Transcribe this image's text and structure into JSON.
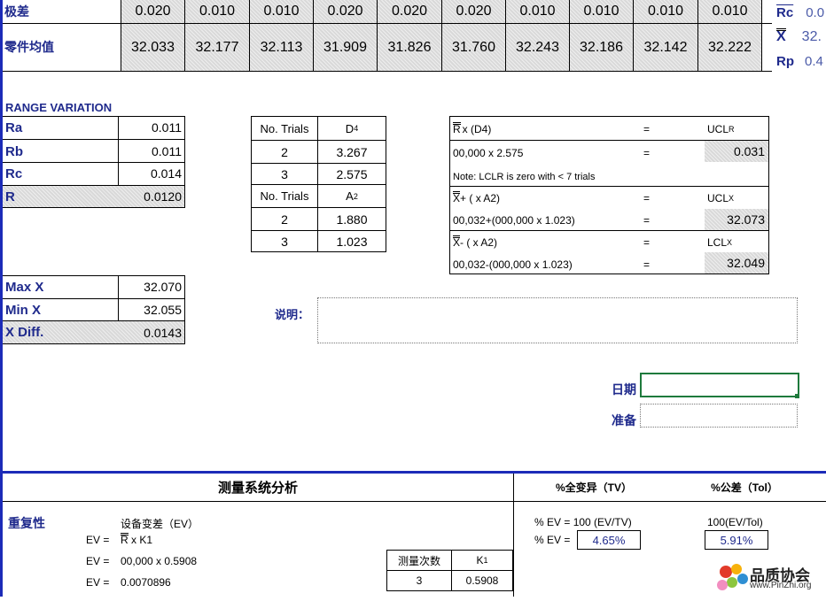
{
  "top": {
    "range_label": "极差",
    "avg_label": "零件均值",
    "ranges": [
      "0.020",
      "0.010",
      "0.010",
      "0.020",
      "0.020",
      "0.020",
      "0.010",
      "0.010",
      "0.010",
      "0.010"
    ],
    "avgs": [
      "32.033",
      "32.177",
      "32.113",
      "31.909",
      "31.826",
      "31.760",
      "32.243",
      "32.186",
      "32.142",
      "32.222"
    ],
    "side": [
      {
        "label": "Rc",
        "value": "0.0"
      },
      {
        "label": "X",
        "value": "32."
      },
      {
        "label": "Rp",
        "value": "0.4"
      }
    ]
  },
  "range_variation": {
    "title": "RANGE VARIATION",
    "rows": [
      {
        "label": "Ra",
        "value": "0.011"
      },
      {
        "label": "Rb",
        "value": "0.011"
      },
      {
        "label": "Rc",
        "value": "0.014"
      },
      {
        "label": "R",
        "value": "0.0120"
      }
    ]
  },
  "constants": {
    "d4_header": [
      "No. Trials",
      "D4"
    ],
    "d4_rows": [
      [
        "2",
        "3.267"
      ],
      [
        "3",
        "2.575"
      ]
    ],
    "a2_header": [
      "No. Trials",
      "A2"
    ],
    "a2_rows": [
      [
        "2",
        "1.880"
      ],
      [
        "3",
        "1.023"
      ]
    ]
  },
  "limits": {
    "r_formula": "x (D4)",
    "eq": "=",
    "ucl_r_label": "UCLR",
    "r_calc": "00,000 x 2.575",
    "ucl_r_value": "0.031",
    "note": "Note: LCLR is zero with < 7 trials",
    "uclx_formula": "+ ( x A2)",
    "ucl_x_label": "UCLX",
    "uclx_calc": "00,032+(000,000 x 1.023)",
    "ucl_x_value": "32.073",
    "lclx_formula": "- ( x A2)",
    "lcl_x_label": "LCLX",
    "lclx_calc": "00,032-(000,000 x 1.023)",
    "lcl_x_value": "32.049"
  },
  "x_stats": {
    "rows": [
      {
        "label": "Max X",
        "value": "32.070"
      },
      {
        "label": "Min X",
        "value": "32.055"
      },
      {
        "label": "X Diff.",
        "value": "0.0143"
      }
    ]
  },
  "notes": {
    "label": "说明：",
    "value": ""
  },
  "sign": {
    "date_label": "日期",
    "prep_label": "准备",
    "date_value": "",
    "prep_value": ""
  },
  "msa": {
    "title": "测量系统分析",
    "tv_header": "%全变异（TV）",
    "tol_header": "%公差（Tol）",
    "repeat_label": "重复性",
    "ev_title": "设备变差（EV）",
    "ev_formula_prefix": "EV =",
    "ev_formula": "x  K1",
    "ev_calc_prefix": "EV =",
    "ev_calc": "00,000 x 0.5908",
    "ev_result_prefix": "EV =",
    "ev_result": "0.0070896",
    "trials_header": [
      "测量次数",
      "K1"
    ],
    "trials_row": [
      "3",
      "0.5908"
    ],
    "ev_tv_formula": "% EV = 100 (EV/TV)",
    "ev_tol_formula": "100(EV/Tol)",
    "ev_pct_label": "% EV =",
    "ev_tv_value": "4.65%",
    "ev_tol_value": "5.91%"
  },
  "watermark": {
    "name": "品质协会",
    "url": "www.PinZhi.org"
  },
  "colors": {
    "accent": "#1f2a8c",
    "border_blue": "#1c2bb8",
    "cell_fill": "#d9d9d9",
    "green": "#1e7a3c"
  }
}
